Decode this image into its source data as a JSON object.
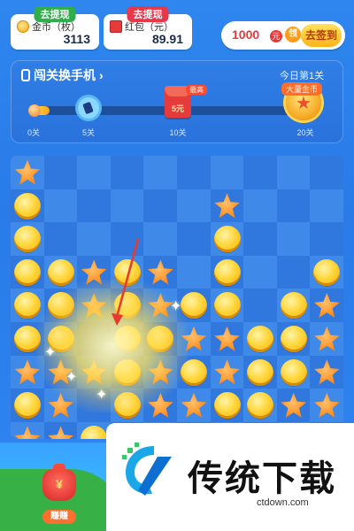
{
  "topbar": {
    "coin": {
      "withdraw_tag": "去提现",
      "label": "金币（枚）",
      "value": "3113",
      "icon": "coin-icon"
    },
    "redpacket": {
      "withdraw_tag": "去提现",
      "label": "红包（元）",
      "value": "89.91",
      "icon": "red-packet-icon"
    },
    "signin": {
      "amount": "1000",
      "unit": "元",
      "tag": "领",
      "button_label": "去签到"
    }
  },
  "level_panel": {
    "title": "闯关换手机",
    "today_text": "今日第1关",
    "progress_fraction": 0.05,
    "milestones": [
      {
        "label": "0关"
      },
      {
        "label": "5关",
        "icon": "gear-icon"
      },
      {
        "label": "10关",
        "icon": "red-packet-icon",
        "reward": "5元",
        "badge": "最高"
      },
      {
        "label": "20关",
        "icon": "medal-icon",
        "badge": "大量金币"
      }
    ]
  },
  "board": {
    "rows": 9,
    "cols": 10,
    "pieces": [
      "S.........",
      "C.....S...",
      "C.....C...",
      "CCSCS.C..C",
      "CCSCSCC.CS",
      "CC.CCSSCCS",
      "SSSCSCSCCS",
      "CS.CSSCCSS",
      "SSCSSSCCSS"
    ],
    "colors": {
      "coin": "#ffd63a",
      "star": "#ff8f1f",
      "board": "#2a6fd8"
    }
  },
  "bottom": {
    "earn_button": "赚赚",
    "bag_symbol": "¥",
    "watermark_title": "传统下载",
    "watermark_url": "ctdown.com"
  }
}
